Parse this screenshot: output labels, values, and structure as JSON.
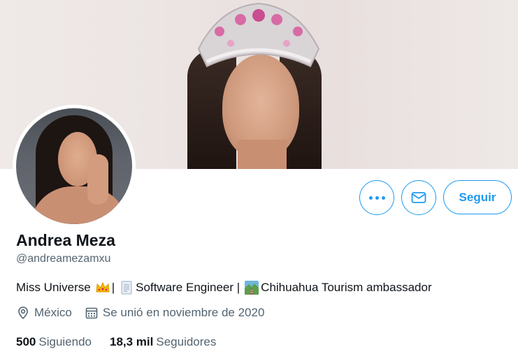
{
  "profile": {
    "name": "Andrea Meza",
    "handle": "@andreamezamxu",
    "bio": {
      "part1": "Miss Universe",
      "sep1": "|",
      "part2": "Software Engineer |",
      "part3": "Chihuahua Tourism ambassador"
    },
    "location": "México",
    "joined": "Se unió en noviembre de 2020",
    "following_count": "500",
    "following_label": "Siguiendo",
    "followers_count": "18,3 mil",
    "followers_label": "Seguidores"
  },
  "actions": {
    "follow_label": "Seguir",
    "more_icon": "more-icon",
    "message_icon": "envelope-icon"
  },
  "colors": {
    "accent": "#1d9bf0",
    "secondary_text": "#536471",
    "primary_text": "#0f1419"
  }
}
